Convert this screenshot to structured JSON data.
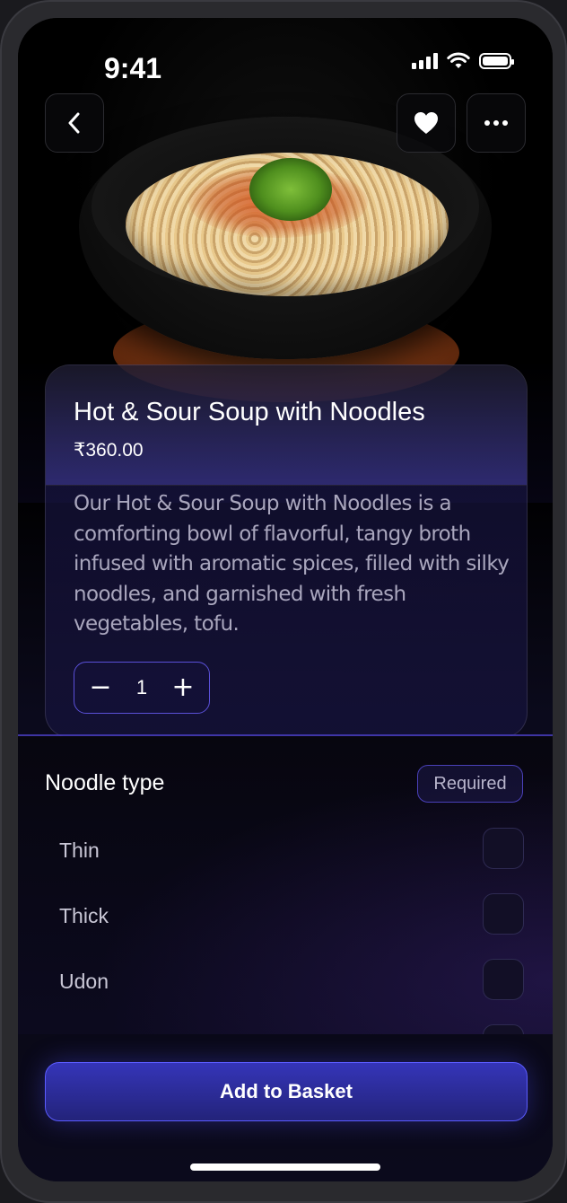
{
  "status_bar": {
    "time": "9:41",
    "signal_bars": 4,
    "battery_level": 1.0
  },
  "header": {
    "back_icon": "chevron-left-icon",
    "favorite_icon": "heart-icon",
    "more_icon": "ellipsis-icon"
  },
  "product": {
    "title": "Hot & Sour Soup with Noodles",
    "price": "₹360.00",
    "description": "Our Hot & Sour Soup with Noodles is a comforting bowl of flavorful, tangy broth infused with aromatic spices, filled with silky noodles, and garnished with fresh vegetables, tofu.",
    "quantity": "1",
    "decrement_label": "−",
    "increment_label": "+"
  },
  "options": {
    "title": "Noodle type",
    "badge": "Required",
    "items": [
      {
        "label": "Thin",
        "checked": false
      },
      {
        "label": "Thick",
        "checked": false
      },
      {
        "label": "Udon",
        "checked": false
      }
    ]
  },
  "footer": {
    "add_button": "Add to Basket"
  },
  "colors": {
    "accent": "#4a40d8",
    "button": "#2c2ca0",
    "background": "#000000"
  }
}
